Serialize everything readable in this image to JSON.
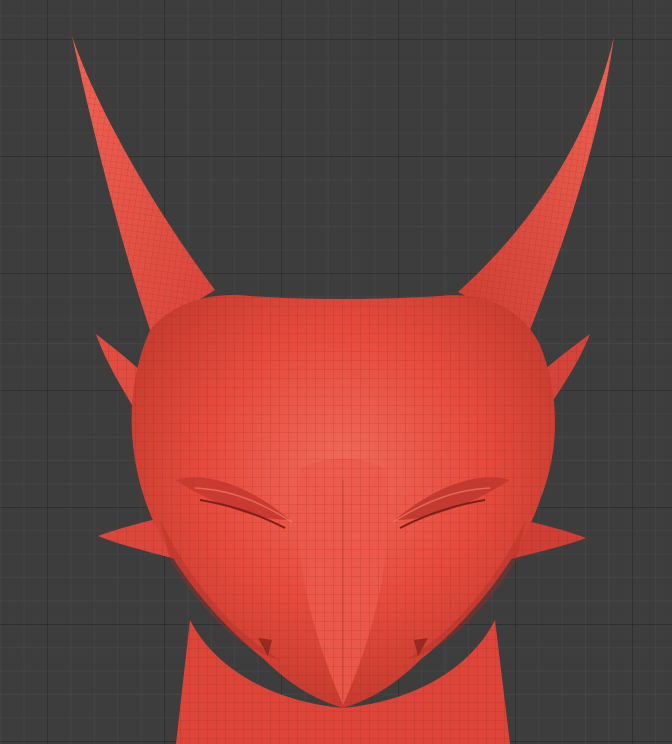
{
  "viewport": {
    "background": "#3d3d3d",
    "grid_major": "#333333",
    "grid_minor": "#424242"
  },
  "model": {
    "subject": "dragon-head-sculpt",
    "shading": "wireframe-overlay",
    "base_color": "#e64b3c",
    "light_color": "#f26b5c",
    "shadow_color": "#b3312a",
    "wire_color": "#7a1e18"
  }
}
